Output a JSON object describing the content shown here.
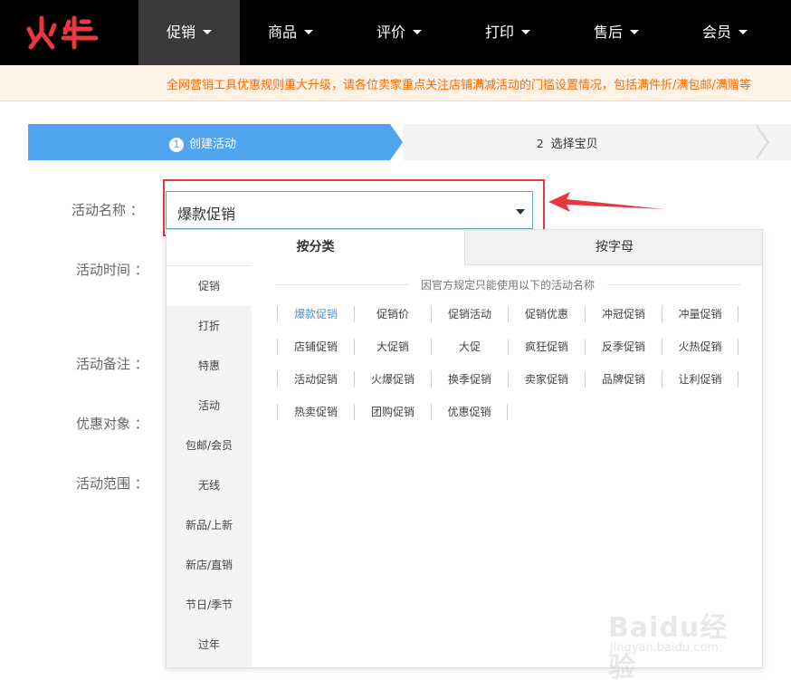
{
  "logo": {
    "text": "火牛",
    "color": "#e8383d"
  },
  "nav": {
    "items": [
      {
        "label": "促销",
        "active": true
      },
      {
        "label": "商品",
        "active": false
      },
      {
        "label": "评价",
        "active": false
      },
      {
        "label": "打印",
        "active": false
      },
      {
        "label": "售后",
        "active": false
      },
      {
        "label": "会员",
        "active": false
      }
    ]
  },
  "notice": {
    "text": "全网营销工具优惠规则重大升级，请各位卖家重点关注店铺满减活动的门槛设置情况，包括满件折/满包邮/满赠等"
  },
  "steps": [
    {
      "num": "1",
      "label": "创建活动",
      "active": true
    },
    {
      "num": "2",
      "label": "选择宝贝",
      "active": false
    }
  ],
  "form": {
    "labels": {
      "name": "活动名称 ：",
      "time": "活动时间 ：",
      "note": "活动备注 ：",
      "target": "优惠对象 ：",
      "scope": "活动范围 ："
    },
    "name_select": {
      "value": "爆款促销"
    }
  },
  "dropdown": {
    "tabs": [
      {
        "label": "按分类",
        "active": true
      },
      {
        "label": "按字母",
        "active": false
      }
    ],
    "categories": [
      "促销",
      "打折",
      "特惠",
      "活动",
      "包邮/会员",
      "无线",
      "新品/上新",
      "新店/直销",
      "节日/季节",
      "过年"
    ],
    "names_title": "因官方规定只能使用以下的活动名称",
    "names": [
      [
        "爆款促销",
        "促销价",
        "促销活动",
        "促销优惠",
        "冲冠促销",
        "冲量促销"
      ],
      [
        "店铺促销",
        "大促销",
        "大促",
        "疯狂促销",
        "反季促销",
        "火热促销"
      ],
      [
        "活动促销",
        "火爆促销",
        "换季促销",
        "卖家促销",
        "品牌促销",
        "让利促销"
      ],
      [
        "热卖促销",
        "团购促销",
        "优惠促销"
      ]
    ],
    "selected_name": "爆款促销"
  },
  "watermark": {
    "text": "Baidu经验",
    "url": "jingyan.baidu.com"
  },
  "colors": {
    "accent": "#50a5ee",
    "highlight": "#e8383d",
    "notice": "#ff6a00",
    "link": "#4a90e2"
  }
}
